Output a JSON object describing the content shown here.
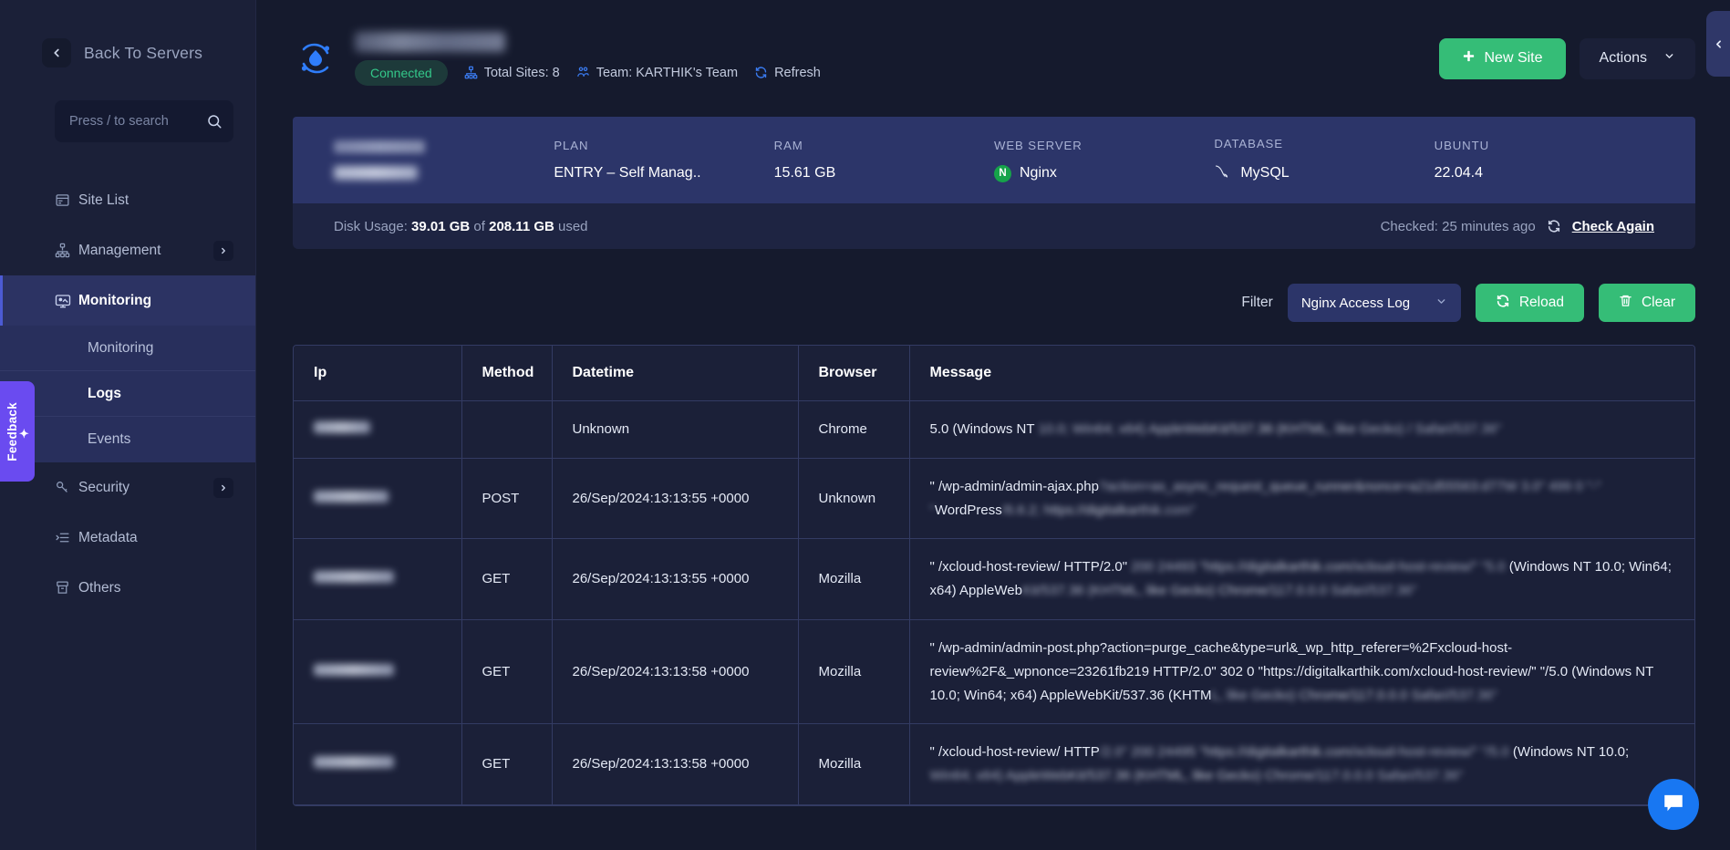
{
  "sidebar": {
    "back_label": "Back To Servers",
    "search_placeholder": "Press / to search",
    "search_value": "",
    "feedback_label": "Feedback",
    "items": [
      {
        "label": "Site List",
        "icon": "browser-icon",
        "has_chevron": false
      },
      {
        "label": "Management",
        "icon": "sitemap-icon",
        "has_chevron": true
      },
      {
        "label": "Monitoring",
        "icon": "monitor-icon",
        "has_chevron": false,
        "active": true
      },
      {
        "label": "Security",
        "icon": "key-icon",
        "has_chevron": true
      },
      {
        "label": "Metadata",
        "icon": "list-icon",
        "has_chevron": false
      },
      {
        "label": "Others",
        "icon": "archive-icon",
        "has_chevron": false
      }
    ],
    "sub_items": [
      {
        "label": "Monitoring",
        "selected": false
      },
      {
        "label": "Logs",
        "selected": true
      },
      {
        "label": "Events",
        "selected": false
      }
    ]
  },
  "header": {
    "server_name": "",
    "status_badge": "Connected",
    "total_sites": "Total Sites: 8",
    "team": "Team: KARTHIK's Team",
    "refresh": "Refresh",
    "new_site_button": "New Site",
    "actions_button": "Actions"
  },
  "stats": [
    {
      "label": "IP ADDRESS",
      "value": "",
      "redacted": true
    },
    {
      "label": "PLAN",
      "value": "ENTRY – Self Manag.."
    },
    {
      "label": "RAM",
      "value": "15.61 GB"
    },
    {
      "label": "WEB SERVER",
      "value": "Nginx",
      "icon": "nginx-icon"
    },
    {
      "label": "DATABASE",
      "value": "MySQL",
      "icon": "mysql-icon"
    },
    {
      "label": "UBUNTU",
      "value": "22.04.4"
    }
  ],
  "disk": {
    "prefix": "Disk Usage:",
    "used": "39.01 GB",
    "of": "of",
    "total": "208.11 GB",
    "suffix": "used",
    "checked": "Checked: 25 minutes ago",
    "check_again": "Check Again"
  },
  "filter": {
    "label": "Filter",
    "selected": "Nginx Access Log",
    "reload_button": "Reload",
    "clear_button": "Clear"
  },
  "table": {
    "columns": [
      "Ip",
      "Method",
      "Datetime",
      "Browser",
      "Message"
    ],
    "rows": [
      {
        "ip": "",
        "ip_width": 62,
        "method": "",
        "datetime": "Unknown",
        "browser": "Chrome",
        "message_visible": "5.0 (Windows NT ",
        "message_redacted": "10.0; Win64; x64) AppleWebKit/537.36 (KHTML, like Gecko) / Safari/537.36\""
      },
      {
        "ip": "",
        "ip_width": 82,
        "method": "POST",
        "datetime": "26/Sep/2024:13:13:55 +0000",
        "browser": "Unknown",
        "message_visible": "\" /wp-admin/admin-ajax.php",
        "message_redacted": "?action=as_async_request_queue_runner&nonce=a21d55563:d77W 3.0\" 499 0 \"-\" \"",
        "message_visible2": "WordPress",
        "message_redacted2": "/6.6.2; https://digitalkarthik.com\""
      },
      {
        "ip": "",
        "ip_width": 88,
        "method": "GET",
        "datetime": "26/Sep/2024:13:13:55 +0000",
        "browser": "Mozilla",
        "message_visible": "\" /xcloud-host-review/ HTTP/2.0\"",
        "message_redacted": " 200 24493 \"https://digitalkarthik.com/xcloud-host-review/\" \"5.0 ",
        "message_visible2": "(Windows NT 10.0; Win64; x64) AppleWeb",
        "message_redacted2": "Kit/537.36 (KHTML, like Gecko) Chrome/117.0.0.0 Safari/537.36\""
      },
      {
        "ip": "",
        "ip_width": 88,
        "method": "GET",
        "datetime": "26/Sep/2024:13:13:58 +0000",
        "browser": "Mozilla",
        "message_visible": "\" /wp-admin/admin-post.php?action=purge_cache&type=url&_wp_http_referer=%2Fxcloud-host-review%2F&_wpnonce=23261fb219 HTTP/2.0\" 302 0 \"https://digitalkarthik.com/xcloud-host-review/\" \"/5.0 (Windows NT 10.0; Win64; x64) AppleWebKit/537.36 (KHTM",
        "message_redacted": "L, like Gecko) Chrome/117.0.0.0 Safari/537.36\""
      },
      {
        "ip": "",
        "ip_width": 88,
        "method": "GET",
        "datetime": "26/Sep/2024:13:13:58 +0000",
        "browser": "Mozilla",
        "message_visible": "\" /xcloud-host-review/ HTTP",
        "message_redacted": "/2.0\" 200 24495 \"https://digitalkarthik.com/xcloud-host-review/\" \"/5.0 ",
        "message_visible2": "(Windows NT 10.0;",
        "message_redacted2": " Win64; x64) AppleWebKit/537.36 (KHTML, like Gecko) Chrome/117.0.0.0 Safari/537.36\""
      }
    ]
  }
}
